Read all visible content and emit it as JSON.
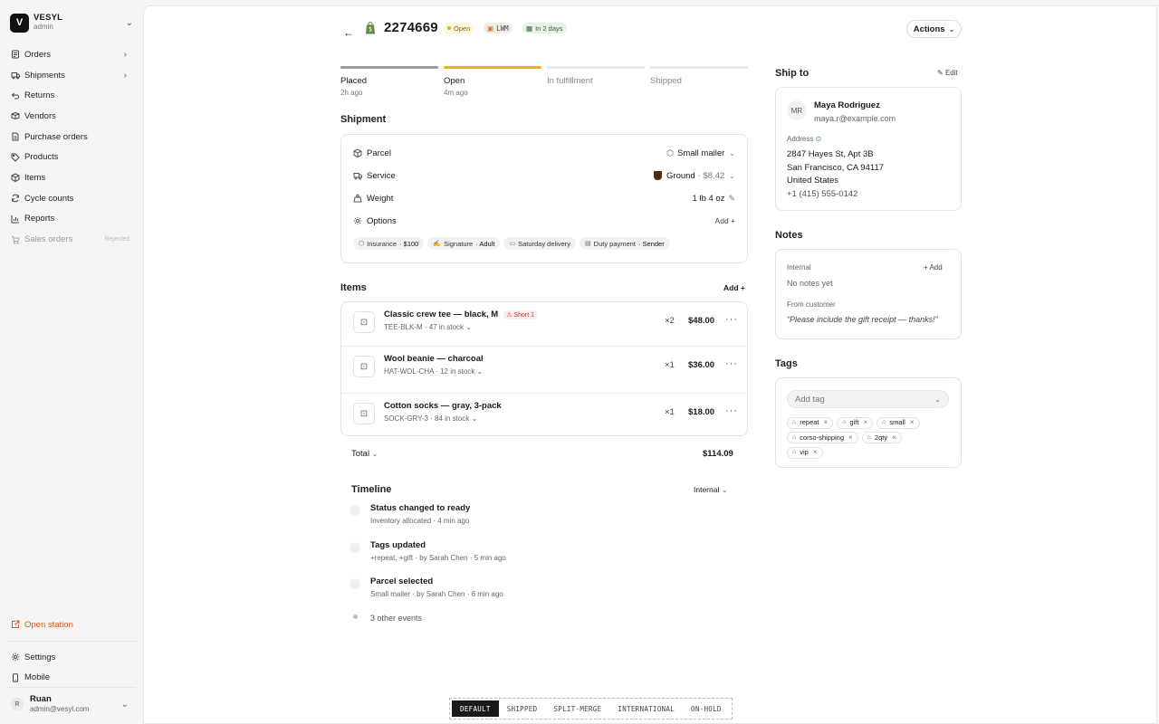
{
  "sidebar": {
    "org_initial": "V",
    "org_name": "VESYL",
    "org_role": "admin",
    "items": [
      {
        "label": "Orders",
        "icon": "orders-icon",
        "has_chevron": true
      },
      {
        "label": "Shipments",
        "icon": "truck-icon",
        "has_chevron": true
      },
      {
        "label": "Returns",
        "icon": "return-icon"
      },
      {
        "label": "Vendors",
        "icon": "vendor-icon"
      },
      {
        "label": "Purchase orders",
        "icon": "file-icon"
      },
      {
        "label": "Products",
        "icon": "tag-icon"
      },
      {
        "label": "Items",
        "icon": "box-icon"
      },
      {
        "label": "Cycle counts",
        "icon": "cycle-icon"
      },
      {
        "label": "Reports",
        "icon": "chart-icon"
      },
      {
        "label": "Sales orders",
        "icon": "cart-icon",
        "badge": "Rejected"
      }
    ],
    "open_station": "Open station",
    "settings": "Settings",
    "mobile": "Mobile",
    "user": {
      "initial": "R",
      "name": "Ruan",
      "email": "admin@vesyl.com"
    }
  },
  "header": {
    "order_id": "2274669",
    "status": "Open",
    "lwm": "LWM",
    "due": "In 2 days",
    "actions": "Actions"
  },
  "progress": [
    {
      "label": "Placed",
      "sub": "2h ago",
      "state": "done"
    },
    {
      "label": "Open",
      "sub": "4m ago",
      "state": "current"
    },
    {
      "label": "In fulfillment",
      "sub": "",
      "state": "future"
    },
    {
      "label": "Shipped",
      "sub": "",
      "state": "future"
    }
  ],
  "shipment": {
    "title": "Shipment",
    "parcel_label": "Parcel",
    "parcel_value": "Small mailer",
    "service_label": "Service",
    "service_value": "Ground",
    "service_price": "· $8.42",
    "weight_label": "Weight",
    "weight_value": "1 lb 4 oz",
    "options_label": "Options",
    "options_add": "Add +",
    "options": [
      {
        "key": "Insurance",
        "value": "$100",
        "icon": "shield-icon"
      },
      {
        "key": "Signature",
        "value": "Adult",
        "icon": "signature-icon"
      },
      {
        "key": "Saturday delivery",
        "value": "",
        "icon": "calendar-icon"
      },
      {
        "key": "Duty payment",
        "value": "Sender",
        "icon": "receipt-icon"
      }
    ]
  },
  "items": {
    "title": "Items",
    "add": "Add +",
    "rows": [
      {
        "name": "Classic crew tee — black, M",
        "short": "Short 1",
        "sku": "TEE-BLK-M",
        "stock": "47 in stock",
        "qty": "×2",
        "price": "$48.00"
      },
      {
        "name": "Wool beanie — charcoal",
        "short": "",
        "sku": "HAT-WOL-CHA",
        "stock": "12 in stock",
        "qty": "×1",
        "price": "$36.00"
      },
      {
        "name": "Cotton socks — gray, 3-pack",
        "short": "",
        "sku": "SOCK-GRY-3",
        "stock": "84 in stock",
        "qty": "×1",
        "price": "$18.00"
      }
    ],
    "total_label": "Total",
    "total_value": "$114.09"
  },
  "timeline": {
    "title": "Timeline",
    "filter": "Internal",
    "events": [
      {
        "title": "Status changed to ready",
        "sub": "Inventory allocated · 4 min ago"
      },
      {
        "title": "Tags updated",
        "sub": "+repeat, +gift · by Sarah Chen · 5 min ago"
      },
      {
        "title": "Parcel selected",
        "sub": "Small mailer · by Sarah Chen · 6 min ago"
      }
    ],
    "more": "3 other events"
  },
  "ship_to": {
    "title": "Ship to",
    "edit": "Edit",
    "initials": "MR",
    "name": "Maya Rodriguez",
    "email": "maya.r@example.com",
    "address_label": "Address",
    "line1": "2847 Hayes St, Apt 3B",
    "line2": "San Francisco, CA 94117",
    "line3": "United States",
    "phone": "+1 (415) 555-0142"
  },
  "notes": {
    "title": "Notes",
    "internal_label": "Internal",
    "add": "+ Add",
    "internal_empty": "No notes yet",
    "customer_label": "From customer",
    "customer_note": "“Please include the gift receipt — thanks!”"
  },
  "tags": {
    "title": "Tags",
    "placeholder": "Add tag",
    "list": [
      "repeat",
      "gift",
      "small",
      "corso-shipping",
      "2qty",
      "vip"
    ]
  },
  "bottom_tabs": [
    "DEFAULT",
    "SHIPPED",
    "SPLIT-MERGE",
    "INTERNATIONAL",
    "ON-HOLD"
  ],
  "colors": {
    "accent_orange": "#e0551b",
    "progress_current": "#f0b400",
    "open_badge": "#eab308"
  }
}
